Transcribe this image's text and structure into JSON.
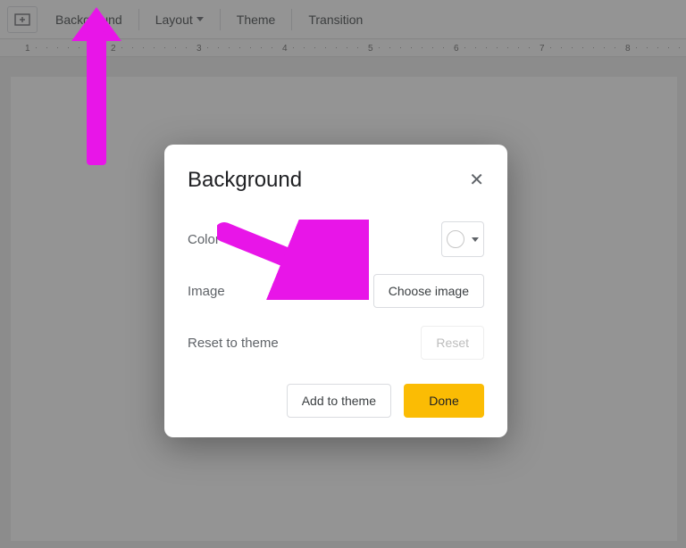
{
  "toolbar": {
    "items": {
      "background": "Background",
      "layout": "Layout",
      "theme": "Theme",
      "transition": "Transition"
    }
  },
  "ruler": {
    "labels": [
      "1",
      "2",
      "3",
      "4",
      "5",
      "6",
      "7",
      "8"
    ]
  },
  "dialog": {
    "title": "Background",
    "rows": {
      "color_label": "Color",
      "image_label": "Image",
      "choose_image_btn": "Choose image",
      "reset_label": "Reset to theme",
      "reset_btn": "Reset"
    },
    "footer": {
      "add_to_theme": "Add to theme",
      "done": "Done"
    }
  }
}
